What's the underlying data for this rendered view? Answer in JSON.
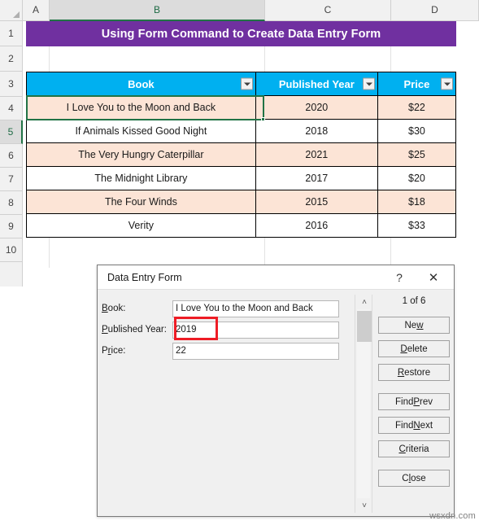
{
  "spreadsheet": {
    "column_headers": [
      "A",
      "B",
      "C",
      "D"
    ],
    "selected_column": "B",
    "row_headers": [
      "1",
      "2",
      "3",
      "4",
      "5",
      "6",
      "7",
      "8",
      "9",
      "10"
    ],
    "selected_row": "5",
    "title_banner": "Using Form Command to Create Data Entry Form",
    "banner_color": "#7030A0",
    "header_color": "#00B0F0",
    "alt_row_color": "#FCE4D6",
    "table": {
      "columns": [
        "Book",
        "Published Year",
        "Price"
      ],
      "rows": [
        [
          "I Love You to the Moon and Back",
          "2020",
          "$22"
        ],
        [
          "If Animals Kissed Good Night",
          "2018",
          "$30"
        ],
        [
          "The Very Hungry Caterpillar",
          "2021",
          "$25"
        ],
        [
          "The Midnight Library",
          "2017",
          "$20"
        ],
        [
          "The Four Winds",
          "2015",
          "$18"
        ],
        [
          "Verity",
          "2016",
          "$33"
        ]
      ]
    }
  },
  "dialog": {
    "title": "Data Entry Form",
    "help_icon": "?",
    "close_icon": "✕",
    "record_counter": "1 of 6",
    "scroll_up_icon": "˄",
    "scroll_down_icon": "˅",
    "fields": [
      {
        "label_pre": "",
        "label_acc": "B",
        "label_post": "ook:",
        "value": "I Love You to the Moon and Back",
        "highlighted": false
      },
      {
        "label_pre": "",
        "label_acc": "P",
        "label_post": "ublished Year:",
        "value": "2019",
        "highlighted": true
      },
      {
        "label_pre": "P",
        "label_acc": "r",
        "label_post": "ice:",
        "value": "22",
        "highlighted": false
      }
    ],
    "buttons": [
      {
        "pre": "Ne",
        "acc": "w",
        "post": ""
      },
      {
        "pre": "",
        "acc": "D",
        "post": "elete"
      },
      {
        "pre": "",
        "acc": "R",
        "post": "estore"
      },
      {
        "pre": "Find ",
        "acc": "P",
        "post": "rev"
      },
      {
        "pre": "Find ",
        "acc": "N",
        "post": "ext"
      },
      {
        "pre": "",
        "acc": "C",
        "post": "riteria"
      },
      {
        "pre": "C",
        "acc": "l",
        "post": "ose"
      }
    ],
    "highlight_color": "#ee1c25"
  },
  "watermark": "wsxdn.com"
}
